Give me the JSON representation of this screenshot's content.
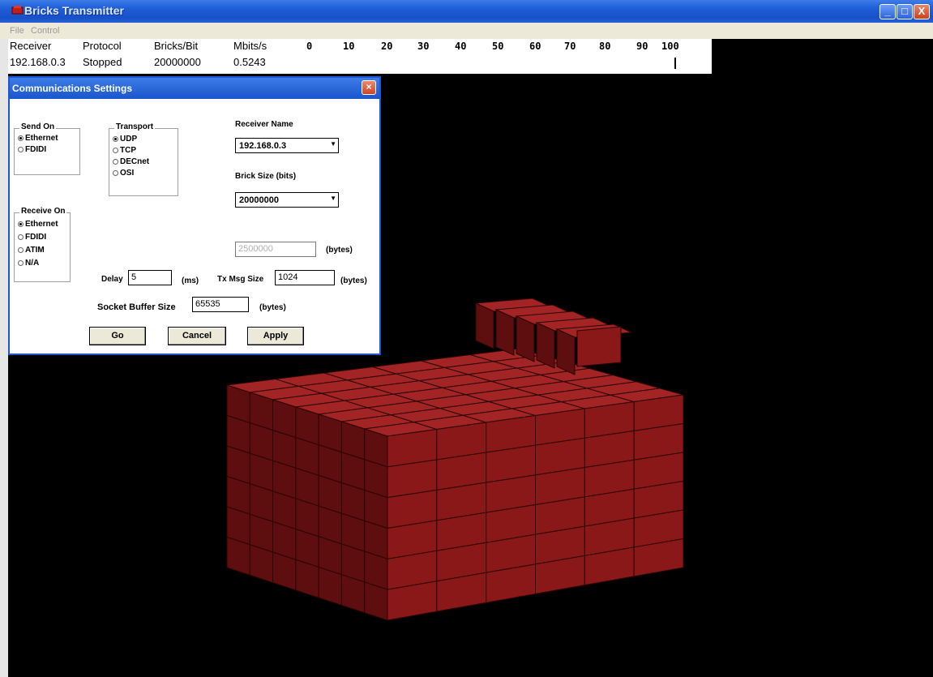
{
  "window": {
    "title": "Bricks Transmitter",
    "minimize_glyph": "_",
    "maximize_glyph": "□",
    "close_glyph": "X",
    "accent": "#1f5fd8",
    "app_icon": "red-brick-icon"
  },
  "menu": {
    "file": "File",
    "control": "Control"
  },
  "status": {
    "headers": {
      "receiver": "Receiver",
      "protocol": "Protocol",
      "bricks_per_bit": "Bricks/Bit",
      "mbits": "Mbits/s"
    },
    "values": {
      "receiver": "192.168.0.3",
      "protocol": "Stopped",
      "bricks_per_bit": "20000000",
      "mbits": "0.5243"
    },
    "scale_ticks": [
      "0",
      "10",
      "20",
      "30",
      "40",
      "50",
      "60",
      "70",
      "80",
      "90",
      "100"
    ],
    "progress_percent": 100
  },
  "dialog": {
    "title": "Communications Settings",
    "close_glyph": "×",
    "send_on": {
      "label": "Send On",
      "options": [
        "Ethernet",
        "FDIDI"
      ],
      "selected": "Ethernet"
    },
    "transport": {
      "label": "Transport",
      "options": [
        "UDP",
        "TCP",
        "DECnet",
        "OSI"
      ],
      "selected": "UDP"
    },
    "receive_on": {
      "label": "Receive On",
      "options": [
        "Ethernet",
        "FDIDI",
        "ATIM",
        "N/A"
      ],
      "selected": "Ethernet"
    },
    "receiver_name": {
      "label": "Receiver Name",
      "value": "192.168.0.3"
    },
    "brick_size": {
      "label": "Brick Size (bits)",
      "value": "20000000"
    },
    "bytes_field": {
      "value": "2500000",
      "unit": "(bytes)"
    },
    "delay": {
      "label": "Delay",
      "value": "5",
      "unit": "(ms)"
    },
    "tx_msg_size": {
      "label": "Tx Msg Size",
      "value": "1024",
      "unit": "(bytes)"
    },
    "socket_buffer": {
      "label": "Socket Buffer Size",
      "value": "65535",
      "unit": "(bytes)"
    },
    "buttons": {
      "go": "Go",
      "cancel": "Cancel",
      "apply": "Apply"
    },
    "dropdown_glyph": "▼"
  },
  "scene": {
    "brick_color": "#8a1818",
    "brick_top_color": "#a32424",
    "brick_side_color": "#5e0e0e",
    "block_columns": 6,
    "block_depth": 7,
    "block_rows": 6,
    "stack_bricks": 5
  }
}
